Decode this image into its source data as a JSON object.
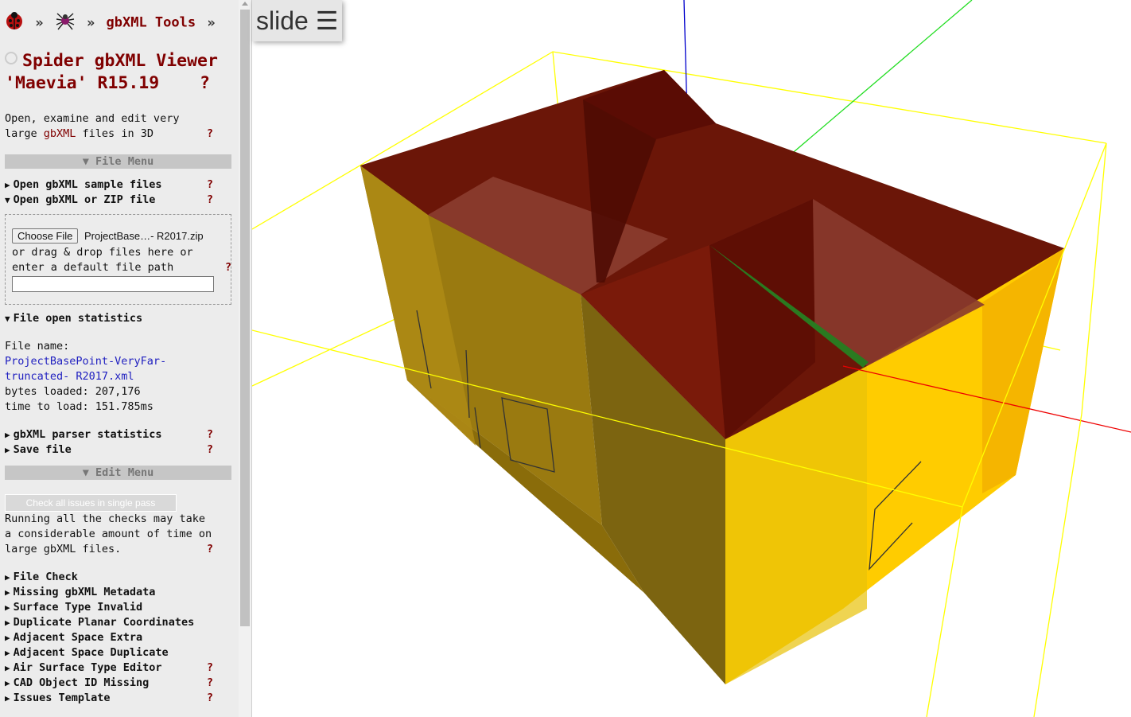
{
  "breadcrumb": {
    "sep1": "»",
    "sep2": "»",
    "tools": "gbXML Tools",
    "sep3": "»"
  },
  "title": {
    "line1": "Spider gbXML Viewer",
    "line2": "'Maevia' R15.19",
    "help": "?"
  },
  "intro": {
    "l1": "Open, examine and edit very",
    "l2a": "large ",
    "l2b": "gbXML",
    "l2c": " files in 3D",
    "help": "?"
  },
  "file_menu": {
    "header": "▼ File Menu",
    "sample": "Open gbXML sample files",
    "open": "Open gbXML or ZIP file",
    "choose_button": "Choose File",
    "chosen_file": "ProjectBase…- R2017.zip",
    "drag1": "or drag & drop files here or",
    "drag2": "enter a default file path",
    "path_value": "",
    "help": "?"
  },
  "stats": {
    "heading": "File open statistics",
    "label_name": "File name:",
    "file1": "ProjectBasePoint-VeryFar-",
    "file2": "truncated- R2017.xml",
    "bytes": "bytes loaded: 207,176",
    "time": "time to load: 151.785ms"
  },
  "more": {
    "parser": "gbXML parser statistics",
    "save": "Save file",
    "help": "?"
  },
  "edit_menu": {
    "header": "▼ Edit Menu",
    "check_button": "Check all issues in single pass",
    "note1": "Running all the checks may take",
    "note2": "a considerable amount of time on",
    "note3": "large gbXML files.",
    "help": "?"
  },
  "checks": [
    {
      "label": "File Check",
      "help": ""
    },
    {
      "label": "Missing gbXML Metadata",
      "help": ""
    },
    {
      "label": "Surface Type Invalid",
      "help": ""
    },
    {
      "label": "Duplicate Planar Coordinates",
      "help": ""
    },
    {
      "label": "Adjacent Space Extra",
      "help": ""
    },
    {
      "label": "Adjacent Space Duplicate",
      "help": ""
    },
    {
      "label": "Air Surface Type Editor",
      "help": "?"
    },
    {
      "label": "CAD Object ID Missing",
      "help": "?"
    },
    {
      "label": "Issues Template",
      "help": "?"
    }
  ],
  "slide": {
    "label": "slide ☰"
  },
  "icons": [
    "ladybug-icon",
    "spider-icon",
    "github-icon"
  ],
  "colors": {
    "accent": "#800000",
    "roof": "#6b1608",
    "wall": "#f0c000",
    "bbox": "#ffff00"
  }
}
